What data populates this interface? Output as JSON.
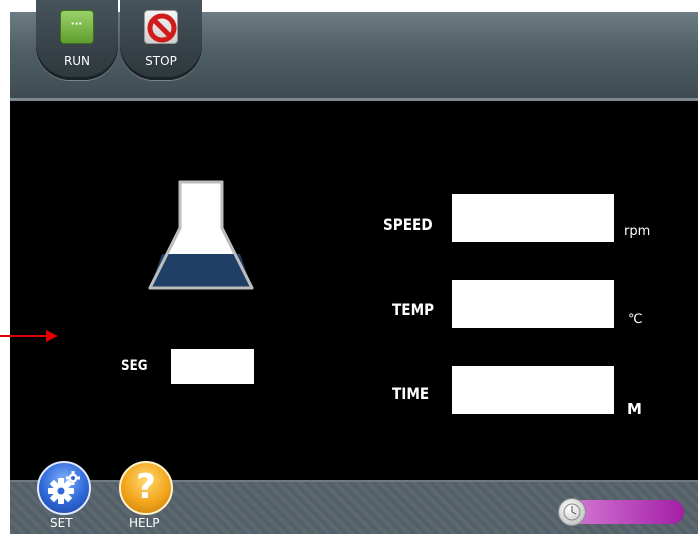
{
  "toolbar": {
    "run_label": "RUN",
    "stop_label": "STOP"
  },
  "main": {
    "seg": {
      "label": "SEG",
      "value": ""
    },
    "params": [
      {
        "label": "SPEED",
        "value": "",
        "unit": "rpm"
      },
      {
        "label": "TEMP",
        "value": "",
        "unit": "℃"
      },
      {
        "label": "TIME",
        "value": "",
        "unit": "M"
      }
    ]
  },
  "bottom": {
    "set_label": "SET",
    "help_label": "HELP"
  },
  "icons": {
    "run": "run-icon",
    "stop": "stop-icon",
    "flask": "flask-icon",
    "set": "gear-icon",
    "help": "question-icon",
    "slider": "clock-icon"
  },
  "colors": {
    "flask_liquid": "#1f3f66",
    "arrow": "#e00000",
    "slider": "#b030b0"
  }
}
